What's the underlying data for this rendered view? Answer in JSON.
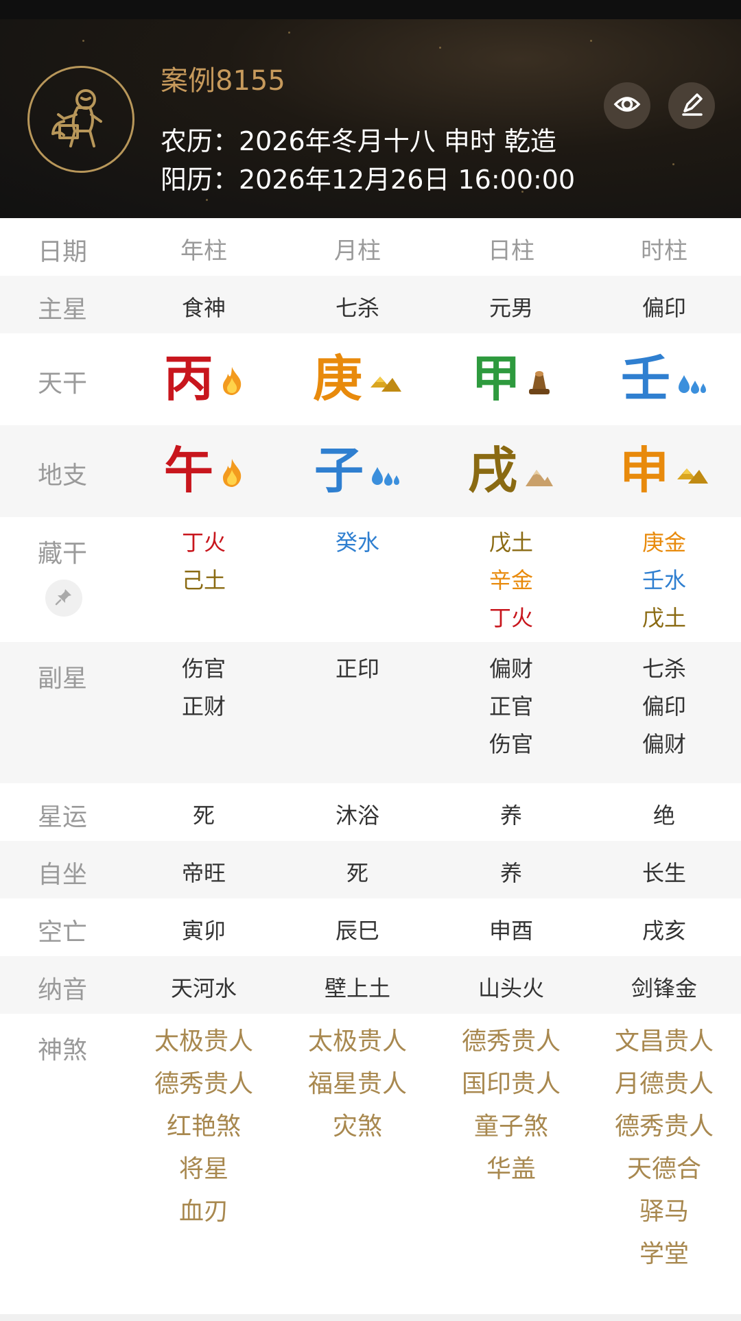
{
  "header": {
    "title": "案例8155",
    "lunar": "农历：2026年冬月十八 申时 乾造",
    "solar": "阳历：2026年12月26日 16:00:00",
    "avatar_icon": "monkey-zodiac-icon",
    "actions": [
      {
        "icon": "eye-icon"
      },
      {
        "icon": "edit-pencil-icon"
      }
    ]
  },
  "columns": {
    "label": "日期",
    "items": [
      "年柱",
      "月柱",
      "日柱",
      "时柱"
    ]
  },
  "rows": {
    "zhuxing": {
      "label": "主星",
      "values": [
        "食神",
        "七杀",
        "元男",
        "偏印"
      ]
    },
    "tiangan": {
      "label": "天干",
      "chars": [
        "丙",
        "庚",
        "甲",
        "壬"
      ],
      "colors": [
        "#c8161d",
        "#e88a0c",
        "#2e9a3e",
        "#2f7fd0"
      ],
      "icons": [
        "fire-icon",
        "metal-gold-icon",
        "wood-icon",
        "water-drops-icon"
      ]
    },
    "dizhi": {
      "label": "地支",
      "chars": [
        "午",
        "子",
        "戌",
        "申"
      ],
      "colors": [
        "#c8161d",
        "#2f7fd0",
        "#8a6a12",
        "#e88a0c"
      ],
      "icons": [
        "fire-icon",
        "water-drops-icon",
        "earth-mountain-icon",
        "metal-gold-icon"
      ]
    },
    "canggan": {
      "label": "藏干",
      "pin_icon": "pin-icon",
      "cols": [
        [
          {
            "t": "丁火",
            "c": "#c8161d"
          },
          {
            "t": "己土",
            "c": "#8a6a12"
          }
        ],
        [
          {
            "t": "癸水",
            "c": "#2f7fd0"
          }
        ],
        [
          {
            "t": "戊土",
            "c": "#8a6a12"
          },
          {
            "t": "辛金",
            "c": "#e88a0c"
          },
          {
            "t": "丁火",
            "c": "#c8161d"
          }
        ],
        [
          {
            "t": "庚金",
            "c": "#e88a0c"
          },
          {
            "t": "壬水",
            "c": "#2f7fd0"
          },
          {
            "t": "戊土",
            "c": "#8a6a12"
          }
        ]
      ]
    },
    "fuxing": {
      "label": "副星",
      "cols": [
        [
          "伤官",
          "正财"
        ],
        [
          "正印"
        ],
        [
          "偏财",
          "正官",
          "伤官"
        ],
        [
          "七杀",
          "偏印",
          "偏财"
        ]
      ]
    },
    "xingyun": {
      "label": "星运",
      "values": [
        "死",
        "沐浴",
        "养",
        "绝"
      ]
    },
    "zizuo": {
      "label": "自坐",
      "values": [
        "帝旺",
        "死",
        "养",
        "长生"
      ]
    },
    "kongwang": {
      "label": "空亡",
      "values": [
        "寅卯",
        "辰巳",
        "申酉",
        "戌亥"
      ]
    },
    "nayin": {
      "label": "纳音",
      "values": [
        "天河水",
        "壁上土",
        "山头火",
        "剑锋金"
      ]
    },
    "shensha": {
      "label": "神煞",
      "cols": [
        [
          "太极贵人",
          "德秀贵人",
          "红艳煞",
          "将星",
          "血刃"
        ],
        [
          "太极贵人",
          "福星贵人",
          "灾煞"
        ],
        [
          "德秀贵人",
          "国印贵人",
          "童子煞",
          "华盖"
        ],
        [
          "文昌贵人",
          "月德贵人",
          "德秀贵人",
          "天德合",
          "驿马",
          "学堂"
        ]
      ]
    }
  }
}
